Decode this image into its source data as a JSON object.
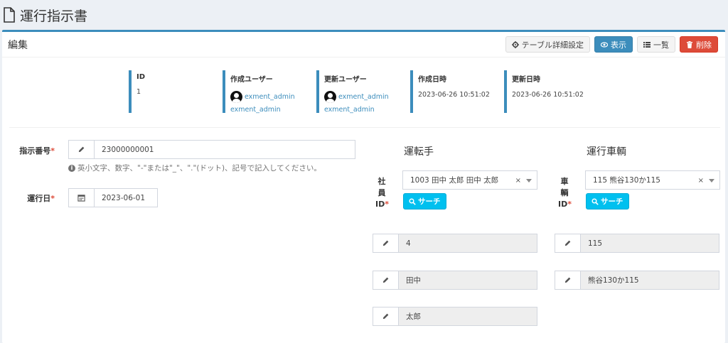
{
  "page": {
    "title": "運行指示書"
  },
  "box": {
    "title": "編集"
  },
  "toolbar": {
    "detail_label": "テーブル詳細設定",
    "view_label": "表示",
    "list_label": "一覧",
    "delete_label": "削除"
  },
  "meta": {
    "id_label": "ID",
    "id_value": "1",
    "created_by_label": "作成ユーザー",
    "created_by_user": "exment_admin",
    "created_by_user2": "exment_admin",
    "updated_by_label": "更新ユーザー",
    "updated_by_user": "exment_admin",
    "updated_by_user2": "exment_admin",
    "created_at_label": "作成日時",
    "created_at_value": "2023-06-26 10:51:02",
    "updated_at_label": "更新日時",
    "updated_at_value": "2023-06-26 10:51:02"
  },
  "form": {
    "order_no_label": "指示番号",
    "order_no_value": "23000000001",
    "order_no_help": "英小文字、数字、\"-\"または\"_\"、\".\"(ドット)、記号で記入してください。",
    "date_label": "運行日",
    "date_value": "2023-06-01",
    "required_mark": "*"
  },
  "driver": {
    "section_title": "運転手",
    "label_chars": [
      "社",
      "員",
      "ID"
    ],
    "select_value": "1003 田中 太郎 田中 太郎",
    "clear": "×",
    "search_label": "サーチ",
    "field1": "4",
    "field2": "田中",
    "field3": "太郎"
  },
  "vehicle": {
    "section_title": "運行車輌",
    "label_chars": [
      "車",
      "輌",
      "ID"
    ],
    "select_value": "115 熊谷130か115",
    "clear": "×",
    "search_label": "サーチ",
    "field1": "115",
    "field2": "熊谷130か115"
  },
  "colors": {
    "primary": "#3c8dbc",
    "danger": "#dd4b39",
    "info": "#00c0ef",
    "required": "#dd4b39"
  }
}
